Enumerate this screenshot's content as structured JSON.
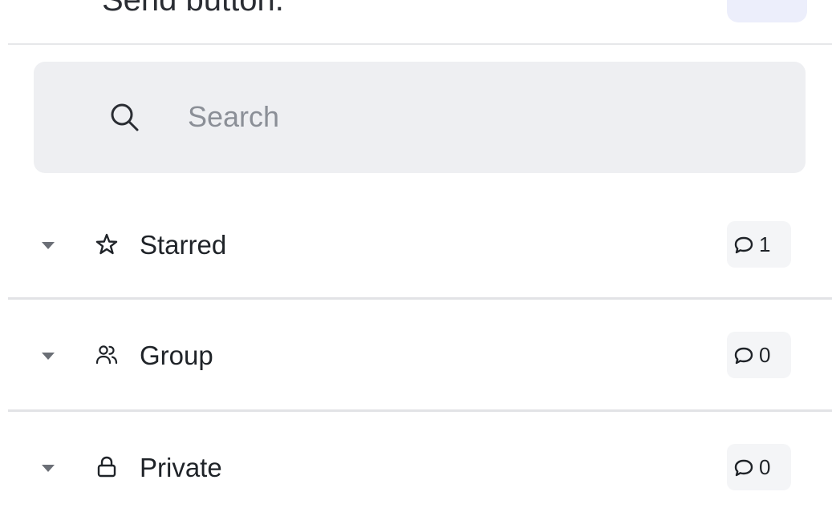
{
  "top_fragment": {
    "text": "Send button."
  },
  "search": {
    "placeholder": "Search",
    "value": ""
  },
  "sections": [
    {
      "label": "Starred",
      "icon": "star-icon",
      "count": "1"
    },
    {
      "label": "Group",
      "icon": "group-icon",
      "count": "0"
    },
    {
      "label": "Private",
      "icon": "lock-icon",
      "count": "0"
    }
  ],
  "colors": {
    "search_bg": "#eeeff2",
    "badge_bg": "#f4f5f7",
    "divider": "#e2e3e6",
    "text": "#1f2328",
    "placeholder": "#8b8f97",
    "accent_pill": "#eceefb"
  }
}
